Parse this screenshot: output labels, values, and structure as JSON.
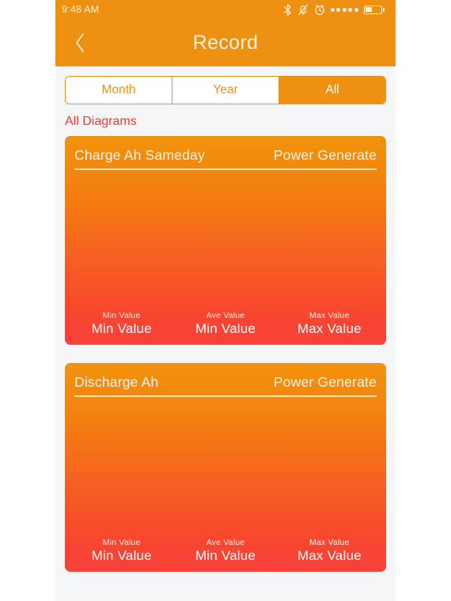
{
  "statusbar": {
    "time": "9:48 AM",
    "icons": [
      "bluetooth-icon",
      "silent-mode-icon",
      "alarm-icon",
      "signal-dots-icon",
      "battery-icon"
    ],
    "signal_dots": 5,
    "battery_level": 45
  },
  "navbar": {
    "back_icon": "chevron-left-icon",
    "title": "Record"
  },
  "segmented_control": {
    "options": [
      {
        "label": "Month",
        "selected": false
      },
      {
        "label": "Year",
        "selected": false
      },
      {
        "label": "All",
        "selected": true
      }
    ],
    "selected": "All"
  },
  "section": {
    "title": "All Diagrams"
  },
  "cards": [
    {
      "title": "Charge Ah Sameday",
      "subtitle": "Power Generate",
      "stats": [
        {
          "label": "Min Value",
          "value": "Min Value"
        },
        {
          "label": "Ave Value",
          "value": "Min Value"
        },
        {
          "label": "Max Value",
          "value": "Max Value"
        }
      ]
    },
    {
      "title": "Discharge Ah",
      "subtitle": "Power Generate",
      "stats": [
        {
          "label": "Min Value",
          "value": "Min Value"
        },
        {
          "label": "Ave Value",
          "value": "Min Value"
        },
        {
          "label": "Max Value",
          "value": "Max Value"
        }
      ]
    }
  ],
  "colors": {
    "brand_orange": "#ee9112",
    "accent_red": "#ee3b2f",
    "card_gradient_top": "#f1930e",
    "card_gradient_bottom": "#f8413a",
    "page_background": "#f4f6f8",
    "nav_text": "#fdf2e0"
  }
}
